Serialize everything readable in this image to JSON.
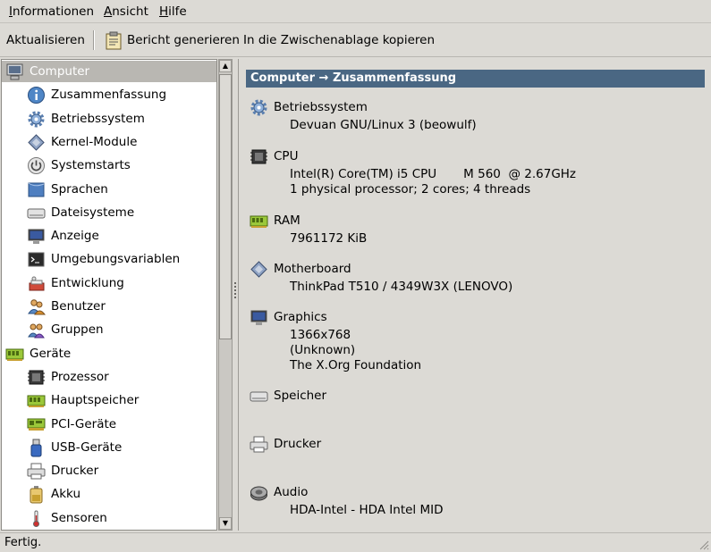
{
  "menubar": {
    "items": [
      {
        "mnemonic": "I",
        "rest": "nformationen"
      },
      {
        "mnemonic": "A",
        "rest": "nsicht"
      },
      {
        "mnemonic": "H",
        "rest": "ilfe"
      }
    ]
  },
  "toolbar": {
    "refresh_label": "Aktualisieren",
    "report_label": "Bericht generieren",
    "copy_label": "In die Zwischenablage kopieren"
  },
  "sidebar": {
    "items": [
      {
        "label": "Computer",
        "icon": "computer-icon",
        "kind": "category",
        "selected": true
      },
      {
        "label": "Zusammenfassung",
        "icon": "info-icon",
        "kind": "item"
      },
      {
        "label": "Betriebssystem",
        "icon": "gear-icon",
        "kind": "item"
      },
      {
        "label": "Kernel-Module",
        "icon": "module-icon",
        "kind": "item"
      },
      {
        "label": "Systemstarts",
        "icon": "power-icon",
        "kind": "item"
      },
      {
        "label": "Sprachen",
        "icon": "flag-icon",
        "kind": "item"
      },
      {
        "label": "Dateisysteme",
        "icon": "drive-icon",
        "kind": "item"
      },
      {
        "label": "Anzeige",
        "icon": "monitor-icon",
        "kind": "item"
      },
      {
        "label": "Umgebungsvariablen",
        "icon": "terminal-icon",
        "kind": "item"
      },
      {
        "label": "Entwicklung",
        "icon": "devel-icon",
        "kind": "item"
      },
      {
        "label": "Benutzer",
        "icon": "users-icon",
        "kind": "item"
      },
      {
        "label": "Gruppen",
        "icon": "group-icon",
        "kind": "item"
      },
      {
        "label": "Geräte",
        "icon": "devices-icon",
        "kind": "category"
      },
      {
        "label": "Prozessor",
        "icon": "cpu-icon",
        "kind": "item"
      },
      {
        "label": "Hauptspeicher",
        "icon": "memory-icon",
        "kind": "item"
      },
      {
        "label": "PCI-Geräte",
        "icon": "pci-icon",
        "kind": "item"
      },
      {
        "label": "USB-Geräte",
        "icon": "usb-icon",
        "kind": "item"
      },
      {
        "label": "Drucker",
        "icon": "printer-icon",
        "kind": "item"
      },
      {
        "label": "Akku",
        "icon": "battery-icon",
        "kind": "item"
      },
      {
        "label": "Sensoren",
        "icon": "thermometer-icon",
        "kind": "item"
      }
    ]
  },
  "content": {
    "header": "Computer → Zusammenfassung",
    "sections": [
      {
        "title": "Betriebssystem",
        "icon": "gear-icon",
        "lines": [
          "Devuan GNU/Linux 3 (beowulf)"
        ]
      },
      {
        "title": "CPU",
        "icon": "cpu-icon",
        "lines": [
          "Intel(R) Core(TM) i5 CPU       M 560  @ 2.67GHz",
          "1 physical processor; 2 cores; 4 threads"
        ]
      },
      {
        "title": "RAM",
        "icon": "memory-icon",
        "lines": [
          "7961172 KiB"
        ]
      },
      {
        "title": "Motherboard",
        "icon": "module-icon",
        "lines": [
          "ThinkPad T510 / 4349W3X (LENOVO)"
        ]
      },
      {
        "title": "Graphics",
        "icon": "monitor-icon",
        "lines": [
          "1366x768",
          "(Unknown)",
          "The X.Org Foundation"
        ]
      },
      {
        "title": "Speicher",
        "icon": "drive-icon",
        "lines": []
      },
      {
        "title": "Drucker",
        "icon": "printer-icon",
        "lines": []
      },
      {
        "title": "Audio",
        "icon": "audio-icon",
        "lines": [
          "HDA-Intel - HDA Intel MID"
        ]
      }
    ]
  },
  "status": {
    "text": "Fertig."
  },
  "colors": {
    "header_bg": "#4a6783",
    "window_bg": "#dcdad5",
    "selection_bg": "#b9b7b2"
  }
}
